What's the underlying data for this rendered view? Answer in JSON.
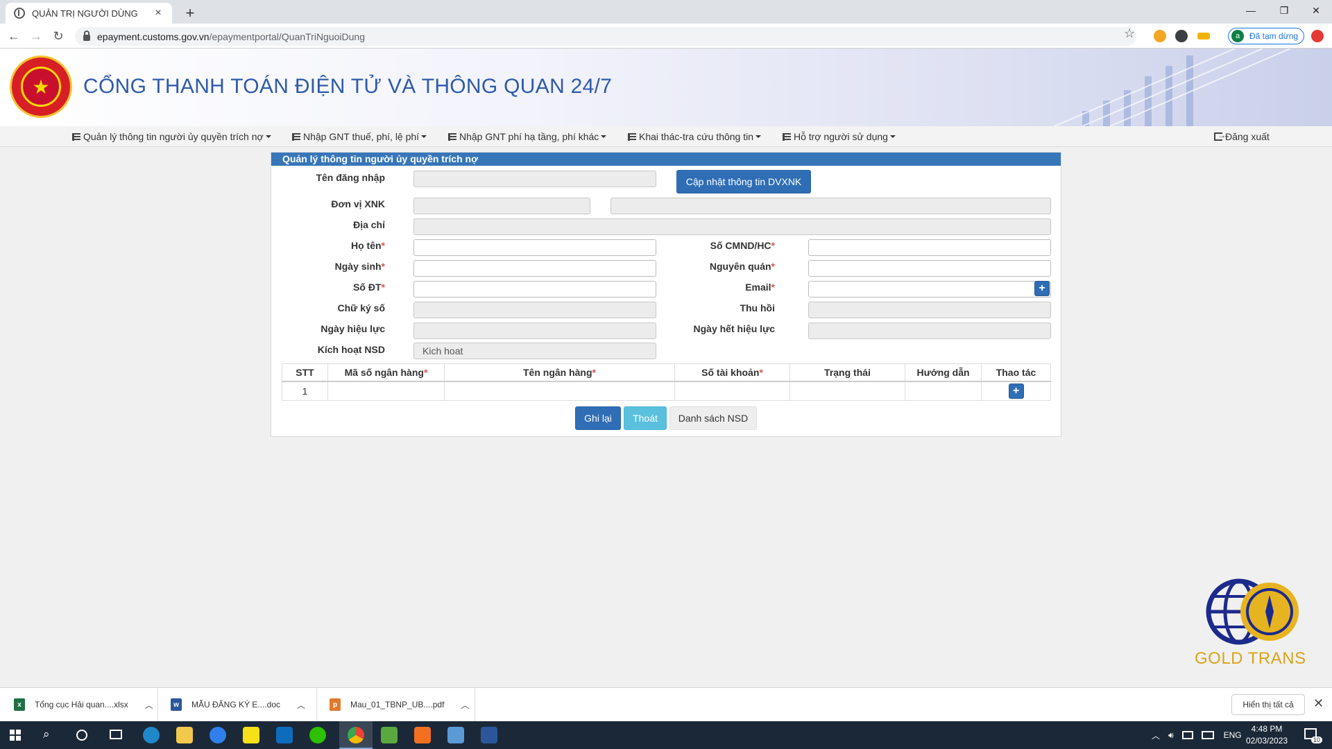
{
  "browser": {
    "tab_title": "QUẢN TRỊ NGƯỜI DÙNG",
    "tab_close": "×",
    "new_tab": "+",
    "url_host": "epayment.customs.gov.vn",
    "url_path": "/epaymentportal/QuanTriNguoiDung",
    "profile_initial": "a",
    "profile_label": "Đã tạm dừng",
    "win_minimize": "—",
    "win_restore": "❐",
    "win_close": "✕"
  },
  "site": {
    "title": "CỔNG THANH TOÁN ĐIỆN TỬ VÀ THÔNG QUAN 24/7"
  },
  "menu": {
    "items": [
      "Quản lý thông tin người ủy quyền trích nợ",
      "Nhập GNT thuế, phí, lệ phí",
      "Nhập GNT phí hạ tầng, phí khác",
      "Khai thác-tra cứu thông tin",
      "Hỗ trợ người sử dụng"
    ],
    "logout": "Đăng xuất"
  },
  "panel": {
    "title": "Quản lý thông tin người ủy quyền trích nợ",
    "update_button": "Cập nhật thông tin DVXNK",
    "labels": {
      "username": "Tên đăng nhập",
      "unit": "Đơn vị XNK",
      "address": "Địa chỉ",
      "fullname": "Họ tên",
      "id_number": "Số CMND/HC",
      "dob": "Ngày sinh",
      "hometown": "Nguyên quán",
      "phone": "Số ĐT",
      "email": "Email",
      "signature": "Chữ ký số",
      "revoke": "Thu hồi",
      "valid_from": "Ngày hiệu lực",
      "valid_to": "Ngày hết hiệu lực",
      "activate": "Kích hoạt NSD"
    },
    "required_mark": "*",
    "activate_value": "Kich hoat",
    "plus": "+",
    "table": {
      "headers": [
        "STT",
        "Mã số ngân hàng",
        "Tên ngân hàng",
        "Số tài khoản",
        "Trạng thái",
        "Hướng dẫn",
        "Thao tác"
      ],
      "required_cols": [
        1,
        2,
        3
      ],
      "rows": [
        {
          "stt": "1"
        }
      ]
    },
    "buttons": {
      "save": "Ghi lại",
      "exit": "Thoát",
      "user_list": "Danh sách NSD"
    }
  },
  "watermark": {
    "brand": "GOLD TRANS"
  },
  "downloads": {
    "items": [
      {
        "name": "Tổng cục Hải quan....xlsx",
        "type": "xlsx"
      },
      {
        "name": "MẪU ĐĂNG KÝ E....doc",
        "type": "doc"
      },
      {
        "name": "Mau_01_TBNP_UB....pdf",
        "type": "pdf"
      }
    ],
    "show_all": "Hiển thị tất cả",
    "close": "✕"
  },
  "taskbar": {
    "lang": "ENG",
    "time": "4:48 PM",
    "date": "02/03/2023",
    "notif_count": "10"
  },
  "colors": {
    "panel_header": "#3776b8",
    "primary_button": "#2f6eb5",
    "exit_button": "#5bc0de",
    "required": "#d9534f",
    "site_title": "#2e5aa8"
  }
}
